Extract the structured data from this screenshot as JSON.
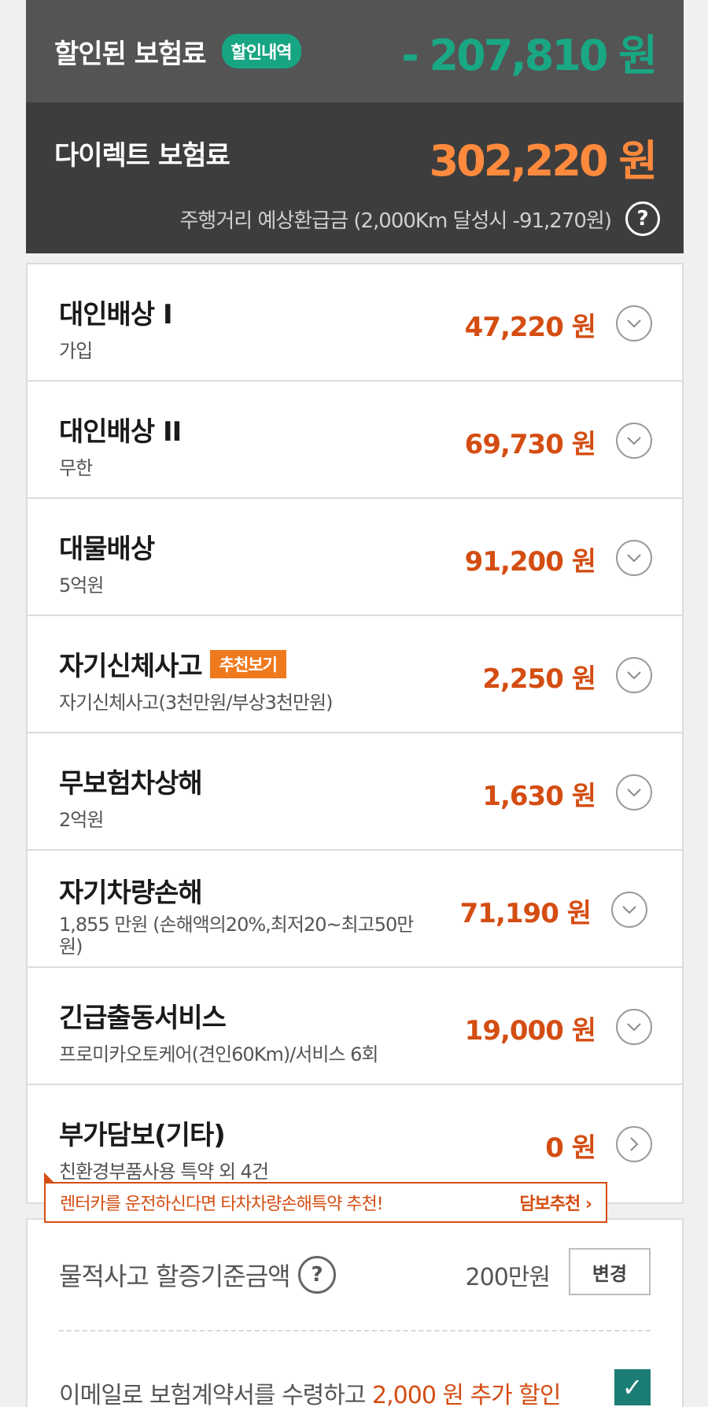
{
  "discount": {
    "title": "할인된 보험료",
    "badge": "할인내역",
    "amount": "- 207,810 원"
  },
  "direct": {
    "title": "다이렉트 보험료",
    "amount": "302,220 원",
    "refund_text": "주행거리 예상환급금 (2,000Km 달성시 -91,270원)",
    "help_icon_glyph": "?"
  },
  "coverages": [
    {
      "title": "대인배상 Ⅰ",
      "sub": "가입",
      "amount": "47,220 원"
    },
    {
      "title": "대인배상 II",
      "sub": "무한",
      "amount": "69,730 원"
    },
    {
      "title": "대물배상",
      "sub": "5억원",
      "amount": "91,200 원"
    },
    {
      "title": "자기신체사고",
      "badge": "추천보기",
      "sub": "자기신체사고(3천만원/부상3천만원)",
      "amount": "2,250 원"
    },
    {
      "title": "무보험차상해",
      "sub": "2억원",
      "amount": "1,630 원"
    },
    {
      "title": "자기차량손해",
      "sub": "1,855 만원 (손해액의20%,최저20~최고50만원)",
      "amount": "71,190 원"
    },
    {
      "title": "긴급출동서비스",
      "sub": "프로미카오토케어(견인60Km)/서비스 6회",
      "amount": "19,000 원"
    },
    {
      "title": "부가담보(기타)",
      "sub": "친환경부품사용 특약 외 4건",
      "amount": "0 원"
    }
  ],
  "promo": {
    "text": "렌터카를 운전하신다면 타차차량손해특약 추천!",
    "link": "담보추천 ›"
  },
  "threshold": {
    "label": "물적사고 할증기준금액",
    "help_glyph": "?",
    "value": "200만원",
    "change_label": "변경"
  },
  "email": {
    "text_prefix": "이메일로 보험계약서를 수령하고 ",
    "text_highlight": "2,000 원 추가 할인",
    "checked": true
  },
  "colors": {
    "discount_green": "#19a784",
    "direct_orange": "#ff8a3d",
    "amount_red": "#d44d12",
    "badge_orange": "#ef7a1e",
    "check_teal": "#1c7d74"
  },
  "icons": {
    "expand": "chevron-down-icon",
    "navigate": "chevron-right-icon",
    "help": "question-circle-icon",
    "check": "checkmark-icon"
  }
}
